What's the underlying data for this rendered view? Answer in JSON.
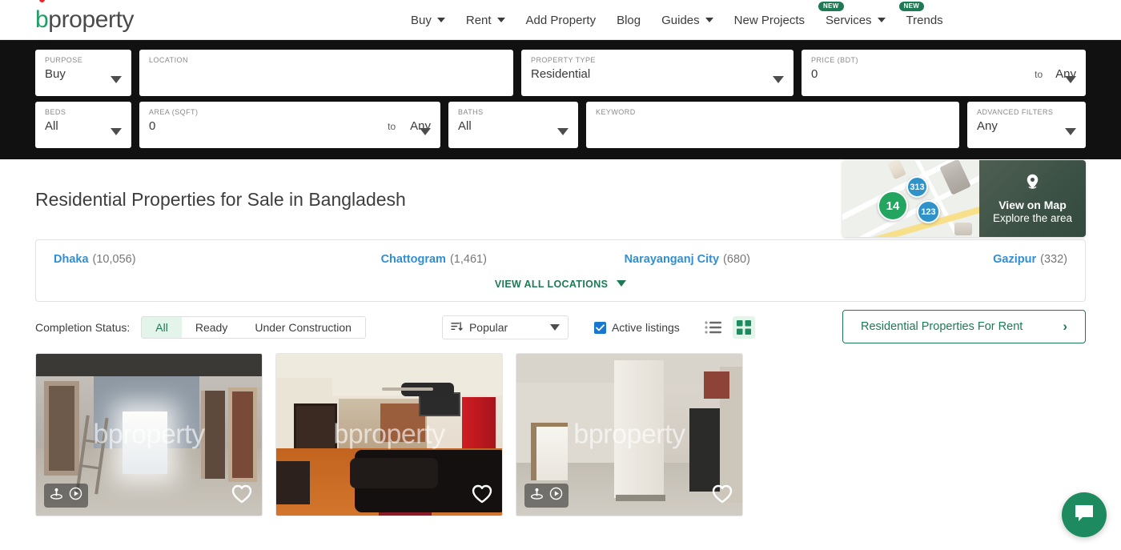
{
  "header": {
    "logo_text_b": "b",
    "logo_text_rest": "property",
    "nav": [
      {
        "label": "Buy",
        "caret": true,
        "badge": null
      },
      {
        "label": "Rent",
        "caret": true,
        "badge": null
      },
      {
        "label": "Add Property",
        "caret": false,
        "badge": null
      },
      {
        "label": "Blog",
        "caret": false,
        "badge": null
      },
      {
        "label": "Guides",
        "caret": true,
        "badge": null
      },
      {
        "label": "New Projects",
        "caret": false,
        "badge": null
      },
      {
        "label": "Services",
        "caret": true,
        "badge": "NEW"
      },
      {
        "label": "Trends",
        "caret": false,
        "badge": "NEW"
      }
    ]
  },
  "search": {
    "purpose": {
      "label": "PURPOSE",
      "value": "Buy"
    },
    "location": {
      "label": "LOCATION",
      "value": ""
    },
    "property_type": {
      "label": "PROPERTY TYPE",
      "value": "Residential"
    },
    "price": {
      "label": "PRICE (BDT)",
      "min": "0",
      "to": "to",
      "max": "Any"
    },
    "beds": {
      "label": "BEDS",
      "value": "All"
    },
    "area": {
      "label": "AREA (SQFT)",
      "min": "0",
      "to": "to",
      "max": "Any"
    },
    "baths": {
      "label": "BATHS",
      "value": "All"
    },
    "keyword": {
      "label": "KEYWORD",
      "value": ""
    },
    "advanced": {
      "label": "ADVANCED FILTERS",
      "value": "Any"
    }
  },
  "main": {
    "page_title": "Residential Properties for Sale in Bangladesh",
    "map_promo": {
      "title": "View on Map",
      "subtitle": "Explore the area",
      "pins": [
        {
          "count": "313",
          "color": "#2f93c9"
        },
        {
          "count": "14",
          "color": "#23a55f"
        },
        {
          "count": "123",
          "color": "#2f93c9"
        }
      ]
    },
    "locations": [
      {
        "name": "Dhaka",
        "count": "(10,056)"
      },
      {
        "name": "Chattogram",
        "count": "(1,461)"
      },
      {
        "name": "Narayanganj City",
        "count": "(680)"
      },
      {
        "name": "Gazipur",
        "count": "(332)"
      }
    ],
    "view_all_locations": "VIEW ALL LOCATIONS",
    "toolbar": {
      "completion_status_label": "Completion Status:",
      "segments": [
        {
          "label": "All",
          "active": true
        },
        {
          "label": "Ready",
          "active": false
        },
        {
          "label": "Under Construction",
          "active": false
        }
      ],
      "sort_value": "Popular",
      "active_listings_label": "Active listings",
      "active_listings_checked": true,
      "rent_cta": "Residential Properties For Rent"
    },
    "cards": [
      {
        "watermark": "bproperty",
        "has_360": true,
        "has_video": true,
        "has_favorite": true
      },
      {
        "watermark": "bproperty",
        "has_360": false,
        "has_video": false,
        "has_favorite": true
      },
      {
        "watermark": "bproperty",
        "has_360": true,
        "has_video": true,
        "has_favorite": true
      }
    ]
  },
  "colors": {
    "brand_green": "#1e7a54",
    "link_blue": "#2f8fd4",
    "accent_red": "#e8282b",
    "searchbar_bg": "#111111"
  }
}
